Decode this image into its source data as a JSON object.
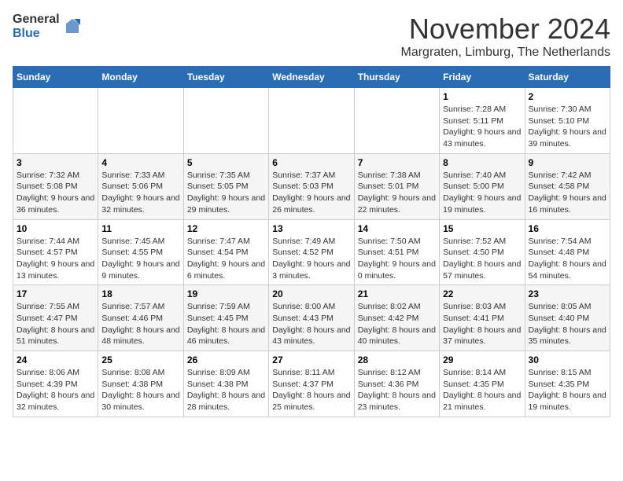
{
  "header": {
    "logo_general": "General",
    "logo_blue": "Blue",
    "month_title": "November 2024",
    "location": "Margraten, Limburg, The Netherlands"
  },
  "weekdays": [
    "Sunday",
    "Monday",
    "Tuesday",
    "Wednesday",
    "Thursday",
    "Friday",
    "Saturday"
  ],
  "weeks": [
    [
      {
        "day": "",
        "info": ""
      },
      {
        "day": "",
        "info": ""
      },
      {
        "day": "",
        "info": ""
      },
      {
        "day": "",
        "info": ""
      },
      {
        "day": "",
        "info": ""
      },
      {
        "day": "1",
        "info": "Sunrise: 7:28 AM\nSunset: 5:11 PM\nDaylight: 9 hours and 43 minutes."
      },
      {
        "day": "2",
        "info": "Sunrise: 7:30 AM\nSunset: 5:10 PM\nDaylight: 9 hours and 39 minutes."
      }
    ],
    [
      {
        "day": "3",
        "info": "Sunrise: 7:32 AM\nSunset: 5:08 PM\nDaylight: 9 hours and 36 minutes."
      },
      {
        "day": "4",
        "info": "Sunrise: 7:33 AM\nSunset: 5:06 PM\nDaylight: 9 hours and 32 minutes."
      },
      {
        "day": "5",
        "info": "Sunrise: 7:35 AM\nSunset: 5:05 PM\nDaylight: 9 hours and 29 minutes."
      },
      {
        "day": "6",
        "info": "Sunrise: 7:37 AM\nSunset: 5:03 PM\nDaylight: 9 hours and 26 minutes."
      },
      {
        "day": "7",
        "info": "Sunrise: 7:38 AM\nSunset: 5:01 PM\nDaylight: 9 hours and 22 minutes."
      },
      {
        "day": "8",
        "info": "Sunrise: 7:40 AM\nSunset: 5:00 PM\nDaylight: 9 hours and 19 minutes."
      },
      {
        "day": "9",
        "info": "Sunrise: 7:42 AM\nSunset: 4:58 PM\nDaylight: 9 hours and 16 minutes."
      }
    ],
    [
      {
        "day": "10",
        "info": "Sunrise: 7:44 AM\nSunset: 4:57 PM\nDaylight: 9 hours and 13 minutes."
      },
      {
        "day": "11",
        "info": "Sunrise: 7:45 AM\nSunset: 4:55 PM\nDaylight: 9 hours and 9 minutes."
      },
      {
        "day": "12",
        "info": "Sunrise: 7:47 AM\nSunset: 4:54 PM\nDaylight: 9 hours and 6 minutes."
      },
      {
        "day": "13",
        "info": "Sunrise: 7:49 AM\nSunset: 4:52 PM\nDaylight: 9 hours and 3 minutes."
      },
      {
        "day": "14",
        "info": "Sunrise: 7:50 AM\nSunset: 4:51 PM\nDaylight: 9 hours and 0 minutes."
      },
      {
        "day": "15",
        "info": "Sunrise: 7:52 AM\nSunset: 4:50 PM\nDaylight: 8 hours and 57 minutes."
      },
      {
        "day": "16",
        "info": "Sunrise: 7:54 AM\nSunset: 4:48 PM\nDaylight: 8 hours and 54 minutes."
      }
    ],
    [
      {
        "day": "17",
        "info": "Sunrise: 7:55 AM\nSunset: 4:47 PM\nDaylight: 8 hours and 51 minutes."
      },
      {
        "day": "18",
        "info": "Sunrise: 7:57 AM\nSunset: 4:46 PM\nDaylight: 8 hours and 48 minutes."
      },
      {
        "day": "19",
        "info": "Sunrise: 7:59 AM\nSunset: 4:45 PM\nDaylight: 8 hours and 46 minutes."
      },
      {
        "day": "20",
        "info": "Sunrise: 8:00 AM\nSunset: 4:43 PM\nDaylight: 8 hours and 43 minutes."
      },
      {
        "day": "21",
        "info": "Sunrise: 8:02 AM\nSunset: 4:42 PM\nDaylight: 8 hours and 40 minutes."
      },
      {
        "day": "22",
        "info": "Sunrise: 8:03 AM\nSunset: 4:41 PM\nDaylight: 8 hours and 37 minutes."
      },
      {
        "day": "23",
        "info": "Sunrise: 8:05 AM\nSunset: 4:40 PM\nDaylight: 8 hours and 35 minutes."
      }
    ],
    [
      {
        "day": "24",
        "info": "Sunrise: 8:06 AM\nSunset: 4:39 PM\nDaylight: 8 hours and 32 minutes."
      },
      {
        "day": "25",
        "info": "Sunrise: 8:08 AM\nSunset: 4:38 PM\nDaylight: 8 hours and 30 minutes."
      },
      {
        "day": "26",
        "info": "Sunrise: 8:09 AM\nSunset: 4:38 PM\nDaylight: 8 hours and 28 minutes."
      },
      {
        "day": "27",
        "info": "Sunrise: 8:11 AM\nSunset: 4:37 PM\nDaylight: 8 hours and 25 minutes."
      },
      {
        "day": "28",
        "info": "Sunrise: 8:12 AM\nSunset: 4:36 PM\nDaylight: 8 hours and 23 minutes."
      },
      {
        "day": "29",
        "info": "Sunrise: 8:14 AM\nSunset: 4:35 PM\nDaylight: 8 hours and 21 minutes."
      },
      {
        "day": "30",
        "info": "Sunrise: 8:15 AM\nSunset: 4:35 PM\nDaylight: 8 hours and 19 minutes."
      }
    ]
  ]
}
